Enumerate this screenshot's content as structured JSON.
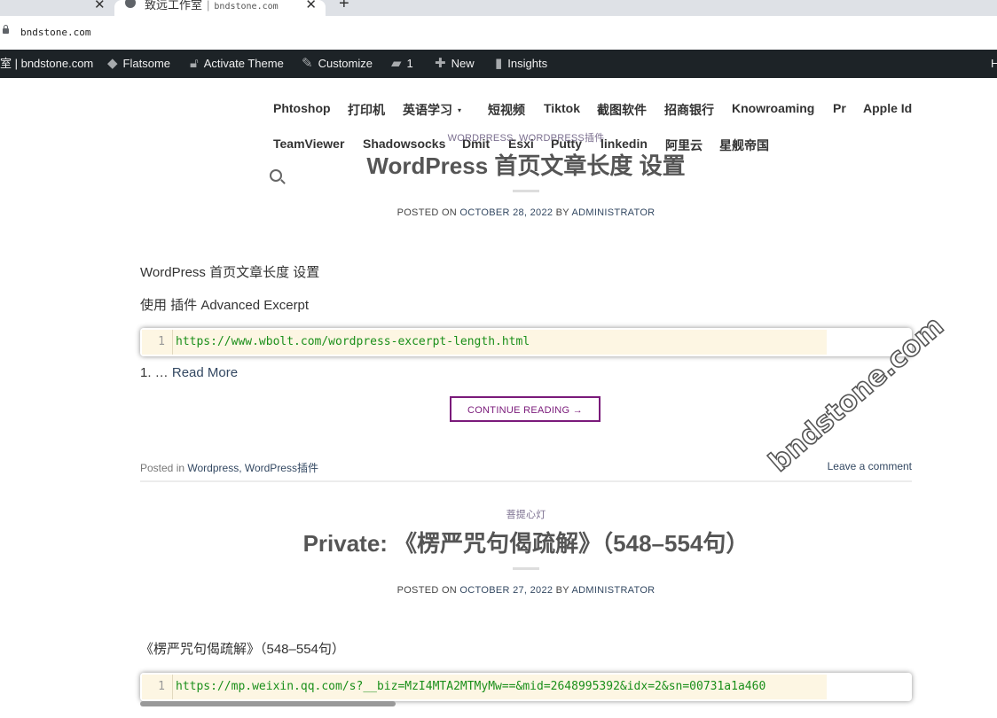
{
  "browser": {
    "tab_title": "致远工作室",
    "tab_host": "bndstone.com",
    "url": "bndstone.com"
  },
  "adminbar": {
    "site_label": "室 | bndstone.com",
    "flatsome": "Flatsome",
    "activate_theme": "Activate Theme",
    "customize": "Customize",
    "comments_count": "1",
    "new": "New",
    "insights": "Insights",
    "right_edge": "H"
  },
  "nav": {
    "row1": [
      "Phtoshop",
      "打印机",
      "英语学习",
      "短视频",
      "Tiktok",
      "截图软件",
      "招商银行",
      "Knowroaming",
      "Pr",
      "Apple Id"
    ],
    "row2": [
      "TeamViewer",
      "Shadowsocks",
      "Dmit",
      "Esxi",
      "Putty",
      "linkedin",
      "阿里云",
      "星舰帝国"
    ],
    "dropdown_caret": "▾"
  },
  "posts": [
    {
      "category": "WORDPRESS, WORDPRESS插件",
      "title": "WordPress 首页文章长度 设置",
      "meta_prefix": "POSTED ON",
      "date": "OCTOBER 28, 2022",
      "meta_by": "BY",
      "author": "ADMINISTRATOR",
      "para1": "WordPress 首页文章长度 设置",
      "para2": "使用 插件 Advanced Excerpt",
      "code_line": "1",
      "code": "https://www.wbolt.com/wordpress-excerpt-length.html",
      "excerpt_prefix": "1. …",
      "read_more": "Read More",
      "continue": "CONTINUE READING →",
      "posted_in": "Posted in",
      "categories_link": "Wordpress, WordPress插件",
      "comment_link": "Leave a comment"
    },
    {
      "category": "菩提心灯",
      "title": "Private: 《楞严咒句偈疏解》（548–554句）",
      "meta_prefix": "POSTED ON",
      "date": "OCTOBER 27, 2022",
      "meta_by": "BY",
      "author": "ADMINISTRATOR",
      "para1": "《楞严咒句偈疏解》（548–554句）",
      "code_line": "1",
      "code": "https://mp.weixin.qq.com/s?__biz=MzI4MTA2MTMyMw==&mid=2648995392&idx=2&sn=00731a1a460"
    }
  ],
  "watermark": "bndstone.com"
}
